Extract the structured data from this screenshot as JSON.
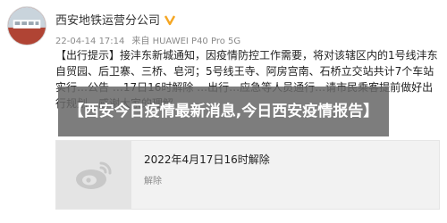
{
  "account": {
    "name": "西安地铁运营分公司",
    "verified_icon": "verified-v-icon",
    "verified_color": "#f5a623"
  },
  "meta": {
    "datetime": "22-04-14 17:14",
    "source": "来自 HUAWEI P40 Pro 5G"
  },
  "post": {
    "tag": "【出行提示】",
    "text": "接沣东新城通知，因疫情防控工作需要，将对该辖区内的1号线沣东自贸园、后卫寨、三桥、皂河；5号线王寺、阿房宫南、石桥立交站共计7个车站实行…公告 …17日16时解除 …出行…应急等人员通行…请市民乘客提前做好出行规划，感谢大家的理解",
    "link_color": "#2b5d9b"
  },
  "overlay": {
    "title": "【西安今日疫情最新消息,今日西安疫情报告】",
    "background": "#686868"
  },
  "card": {
    "thumb_icon": "weibo-logo-icon",
    "title": "2022年4月17日16时解除",
    "subtitle": "解除"
  }
}
